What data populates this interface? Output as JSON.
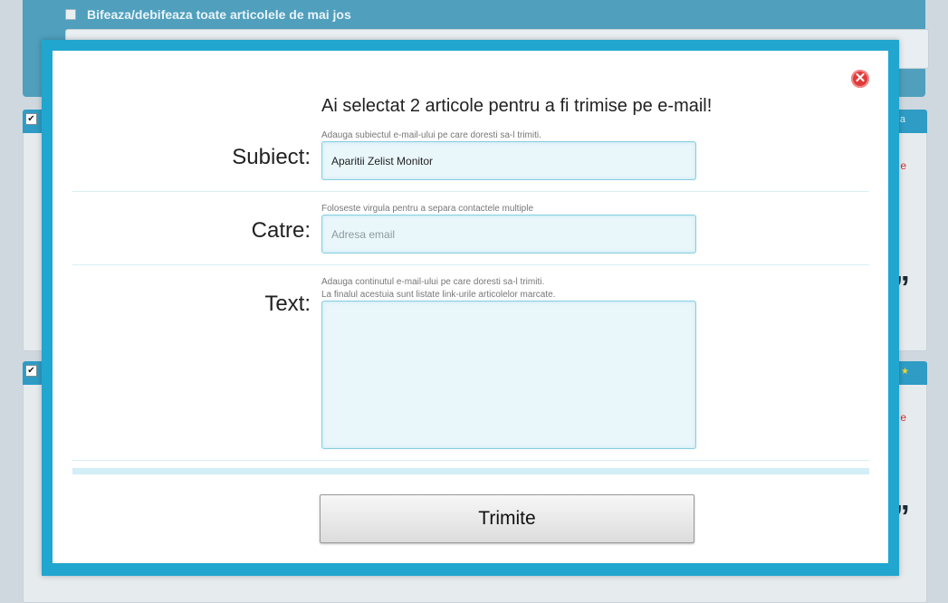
{
  "background": {
    "select_all_label": "Bifeaza/debifeaza toate articolele de mai jos",
    "articles": [
      {
        "checked_mark": "✔",
        "side_link": "a",
        "side_red": "e",
        "quote_mark": "”"
      },
      {
        "checked_mark": "✔",
        "side_link": "★",
        "side_red": "e",
        "quote_mark": "”"
      }
    ]
  },
  "modal": {
    "close_icon": "✕",
    "title": "Ai selectat 2 articole pentru a fi trimise pe e-mail!",
    "subject": {
      "label": "Subiect:",
      "hint": "Adauga subiectul e-mail-ului pe care doresti sa-l trimiti.",
      "value": "Aparitii Zelist Monitor"
    },
    "to": {
      "label": "Catre:",
      "hint": "Foloseste virgula pentru a separa contactele multiple",
      "placeholder": "Adresa email",
      "value": ""
    },
    "text": {
      "label": "Text:",
      "hint_line1": "Adauga continutul e-mail-ului pe care doresti sa-l trimiti.",
      "hint_line2": "La finalul acestuia sunt listate link-urile articolelor marcate.",
      "value": ""
    },
    "submit_label": "Trimite"
  },
  "colors": {
    "modal_border": "#21a6cf",
    "field_bg": "#e9f7fb",
    "close_red": "#e03b3b"
  }
}
